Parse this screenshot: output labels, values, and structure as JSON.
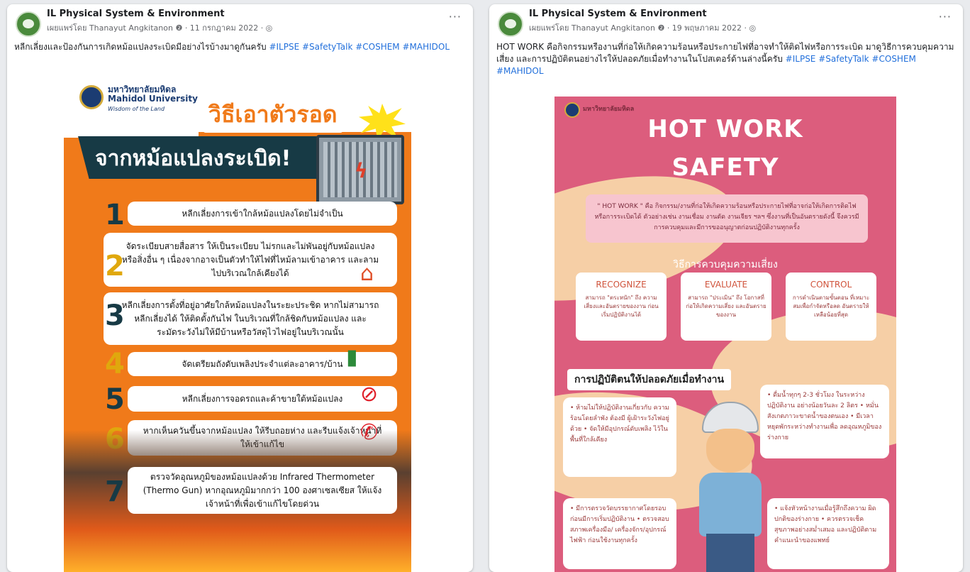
{
  "posts": [
    {
      "page_name": "IL Physical System & Environment",
      "meta": "เผยแพร่โดย Thanayut Angkitanon ❷ · 11 กรกฎาคม 2022 · ◎",
      "text": "หลีกเลี่ยงและป้องกันการเกิดหม้อแปลงระเบิดมีอย่างไรบ้างมาดูกันครับ",
      "tags": "#ILPSE #SafetyTalk #COSHEM #MAHIDOL",
      "infographic": {
        "university": "มหาวิทยาลัยมหิดล",
        "university_en": "Mahidol University",
        "motto": "Wisdom of the Land",
        "title_line1": "วิธีเอาตัวรอด",
        "title_line2": "จากหม้อแปลงระเบิด!",
        "items": [
          {
            "num": "1",
            "text": "หลีกเลี่ยงการเข้าใกล้หม้อแปลงโดยไม่จำเป็น"
          },
          {
            "num": "2",
            "text": "จัดระเบียบสายสื่อสาร ให้เป็นระเบียบ ไม่รกและไม่พันอยู่กับหม้อแปลง หรือสิ่งอื่น ๆ เนื่องจากอาจเป็นตัวทำให้ไฟที่ไหม้ลามเข้าอาคาร และลามไปบริเวณใกล้เคียงได้"
          },
          {
            "num": "3",
            "text": "หลีกเลี่ยงการตั้งที่อยู่อาศัยใกล้หม้อแปลงในระยะประชิด หากไม่สามารถหลีกเลี่ยงได้ ให้ติดตั้งกันไฟ ในบริเวณที่ใกล้ชิดกับหม้อแปลง และระมัดระวังไม่ให้มีบ้านหรือวัสดุไวไฟอยู่ในบริเวณนั้น"
          },
          {
            "num": "4",
            "text": "จัดเตรียมถังดับเพลิงประจำแต่ละอาคาร/บ้าน"
          },
          {
            "num": "5",
            "text": "หลีกเลี่ยงการจอดรถและค้าขายใต้หม้อแปลง"
          },
          {
            "num": "6",
            "text": "หากเห็นควันขึ้นจากหม้อแปลง ให้รีบถอยห่าง และรีบแจ้งเจ้าหน้าที่ให้เข้าแก้ไข"
          },
          {
            "num": "7",
            "text": "ตรวจวัดอุณหภูมิของหม้อแปลงด้วย Infrared Thermometer (Thermo Gun) หากอุณหภูมิมากกว่า 100 องศาเซลเซียส ให้แจ้งเจ้าหน้าที่เพื่อเข้าแก้ไขโดยด่วน"
          }
        ]
      }
    },
    {
      "page_name": "IL Physical System & Environment",
      "meta": "เผยแพร่โดย Thanayut Angkitanon ❷ · 19 พฤษภาคม 2022 · ◎",
      "text": "HOT WORK คือกิจกรรมหรืองานที่ก่อให้เกิดความร้อนหรือประกายไฟที่อาจทำให้ติดไฟหรือการระเบิด มาดูวิธีการควบคุมความเสี่ยง และการปฏิบัติตนอย่างไรให้ปลอดภัยเมื่อทำงานในโปสเตอร์ด้านล่างนี้ครับ",
      "tags": "#ILPSE #SafetyTalk #COSHEM #MAHIDOL",
      "infographic": {
        "university": "มหาวิทยาลัยมหิดล",
        "title_line1": "HOT WORK",
        "title_line2": "SAFETY",
        "definition": "\" HOT WORK \" คือ กิจกรรม/งานที่ก่อให้เกิดความร้อนหรือประกายไฟที่อาจก่อให้เกิดการติดไฟ หรือการระเบิดได้ ตัวอย่างเช่น งานเชื่อม งานตัด งานเจียร ฯลฯ ซึ่งงานที่เป็นอันตรายดังนี้ จึงควรมีการควบคุมและมีการขออนุญาตก่อนปฏิบัติงานทุกครั้ง",
        "risk_title": "วิธีการควบคุมความเสี่ยง",
        "cards": [
          {
            "heading": "RECOGNIZE",
            "desc": "สามารถ \"ตระหนัก\" ถึง ความเสี่ยงและอันตรายของงาน ก่อนเริ่มปฏิบัติงานได้"
          },
          {
            "heading": "EVALUATE",
            "desc": "สามารถ \"ประเมิน\" ถึง โอกาสที่ก่อให้เกิดความเสี่ยง และอันตรายของงาน"
          },
          {
            "heading": "CONTROL",
            "desc": "การดำเนินตามขั้นตอน ที่เหมาะสมเพื่อกำจัดหรือลด อันตรายให้เหลือน้อยที่สุด"
          }
        ],
        "safe_title": "การปฏิบัติตนให้ปลอดภัยเมื่อทำงาน",
        "bubbles": [
          "• ห้ามไม่ให้ปฏิบัติงานเกี่ยวกับ ความร้อนโดยลำพัง ต้องมี ผู้เฝ้าระวังไฟอยู่ด้วย • จัดให้มีอุปกรณ์ดับเพลิง ไว้ในพื้นที่ใกล้เคียง",
          "• ดื่มน้ำทุกๆ 2-3 ชั่วโมง ในระหว่าง ปฏิบัติงาน อย่างน้อยวันละ 2 ลิตร • หมั่นสังเกตภาวะขาดน้ำของตนเอง • มีเวลาหยุดพักระหว่างทำงานเพื่อ ลดอุณหภูมิของร่างกาย",
          "• มีการตรวจวัดบรรยากาศโดยรอบ ก่อนมีการเริ่มปฏิบัติงาน • ตรวจสอบสภาพเครื่องมือ/ เครื่องจักร/อุปกรณ์ไฟฟ้า ก่อนใช้งานทุกครั้ง",
          "• แจ้งหัวหน้างานเมื่อรู้สึกถึงความ ผิดปกติของร่างกาย • ควรตรวจเช็คสุขภาพอย่างสม่ำเสมอ และปฏิบัติตามคำแนะนำของแพทย์"
        ]
      }
    }
  ],
  "more_label": "···"
}
